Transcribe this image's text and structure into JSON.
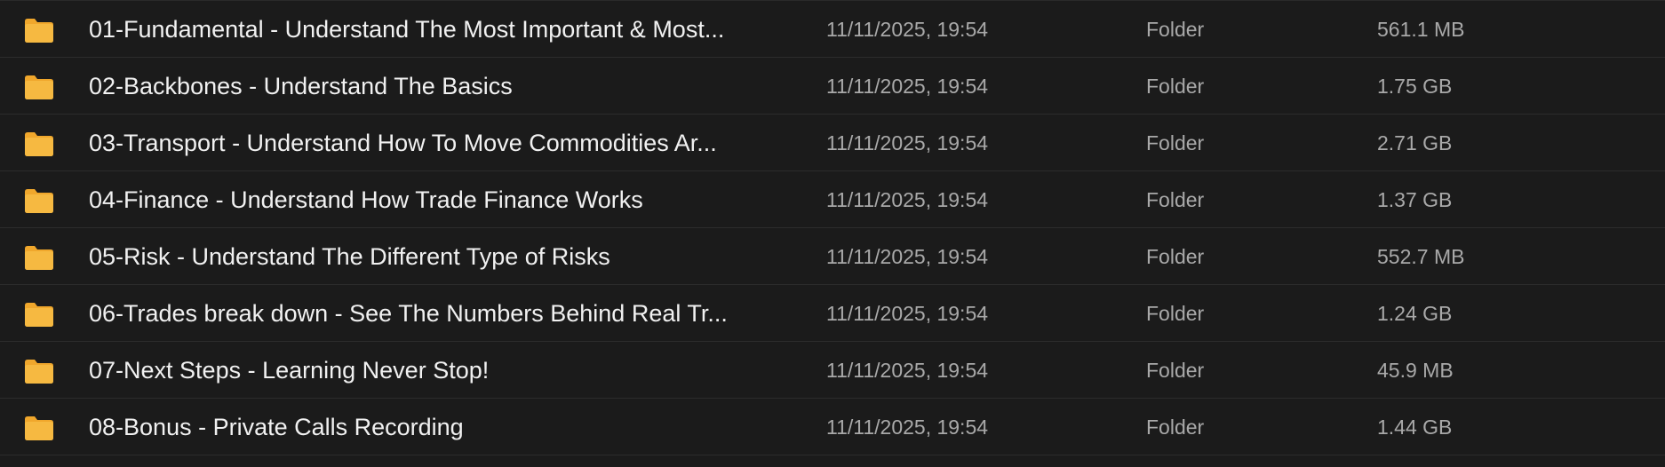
{
  "colors": {
    "background": "#1b1b1b",
    "row_divider": "#2c2c2c",
    "name_text": "#f1f1f1",
    "meta_text": "#a9a9a9",
    "folder_icon": "#f6b941",
    "folder_icon_tab": "#f0a72c"
  },
  "file_list": {
    "rows": [
      {
        "icon": "folder-icon",
        "name": "01-Fundamental - Understand The Most Important & Most...",
        "modified": "11/11/2025, 19:54",
        "kind": "Folder",
        "size": "561.1 MB"
      },
      {
        "icon": "folder-icon",
        "name": "02-Backbones - Understand The Basics",
        "modified": "11/11/2025, 19:54",
        "kind": "Folder",
        "size": "1.75 GB"
      },
      {
        "icon": "folder-icon",
        "name": "03-Transport - Understand How To Move Commodities Ar...",
        "modified": "11/11/2025, 19:54",
        "kind": "Folder",
        "size": "2.71 GB"
      },
      {
        "icon": "folder-icon",
        "name": "04-Finance - Understand How Trade Finance Works",
        "modified": "11/11/2025, 19:54",
        "kind": "Folder",
        "size": "1.37 GB"
      },
      {
        "icon": "folder-icon",
        "name": "05-Risk - Understand The Different Type of Risks",
        "modified": "11/11/2025, 19:54",
        "kind": "Folder",
        "size": "552.7 MB"
      },
      {
        "icon": "folder-icon",
        "name": "06-Trades break down - See The Numbers Behind Real Tr...",
        "modified": "11/11/2025, 19:54",
        "kind": "Folder",
        "size": "1.24 GB"
      },
      {
        "icon": "folder-icon",
        "name": "07-Next Steps - Learning Never Stop!",
        "modified": "11/11/2025, 19:54",
        "kind": "Folder",
        "size": "45.9 MB"
      },
      {
        "icon": "folder-icon",
        "name": "08-Bonus - Private Calls Recording",
        "modified": "11/11/2025, 19:54",
        "kind": "Folder",
        "size": "1.44 GB"
      }
    ]
  }
}
